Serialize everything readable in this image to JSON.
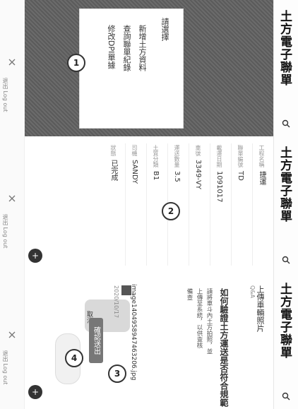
{
  "app": {
    "title": "土方電子聯單"
  },
  "footer": {
    "label": "退出 Log out"
  },
  "panel1": {
    "menu_title": "請選擇",
    "items": [
      "新增土方資料",
      "查詢聯單紀錄",
      "修改DPI單據"
    ],
    "step": "1"
  },
  "panel2": {
    "step": "2",
    "fields": [
      {
        "label": "工程名稱",
        "value": "捷運"
      },
      {
        "label": "聯單編號",
        "value": "TD"
      },
      {
        "label": "載運日期",
        "value": "1091017"
      },
      {
        "label": "車號",
        "value": "3349-VY"
      },
      {
        "label": "運送數量",
        "value": "3.5"
      },
      {
        "label": "土質分類",
        "value": "B1"
      },
      {
        "label": "司機",
        "value": "SANDY"
      },
      {
        "label": "狀態",
        "value": "已完成"
      }
    ]
  },
  "panel3": {
    "step_submit": "3",
    "step_upload": "4",
    "header_title": "上傳車輛照片",
    "header_sub": "Q&A",
    "question": "如何驗證土方運送是否符合規範",
    "desc_lines": [
      "請將車斗內土方拍照，並",
      "上傳至系統，以供查核",
      "備查"
    ],
    "image_name": "image1404958947463206.jpg",
    "image_date": "2020/10/17",
    "cancel_label": "取消",
    "submit_label": "確認送出"
  }
}
